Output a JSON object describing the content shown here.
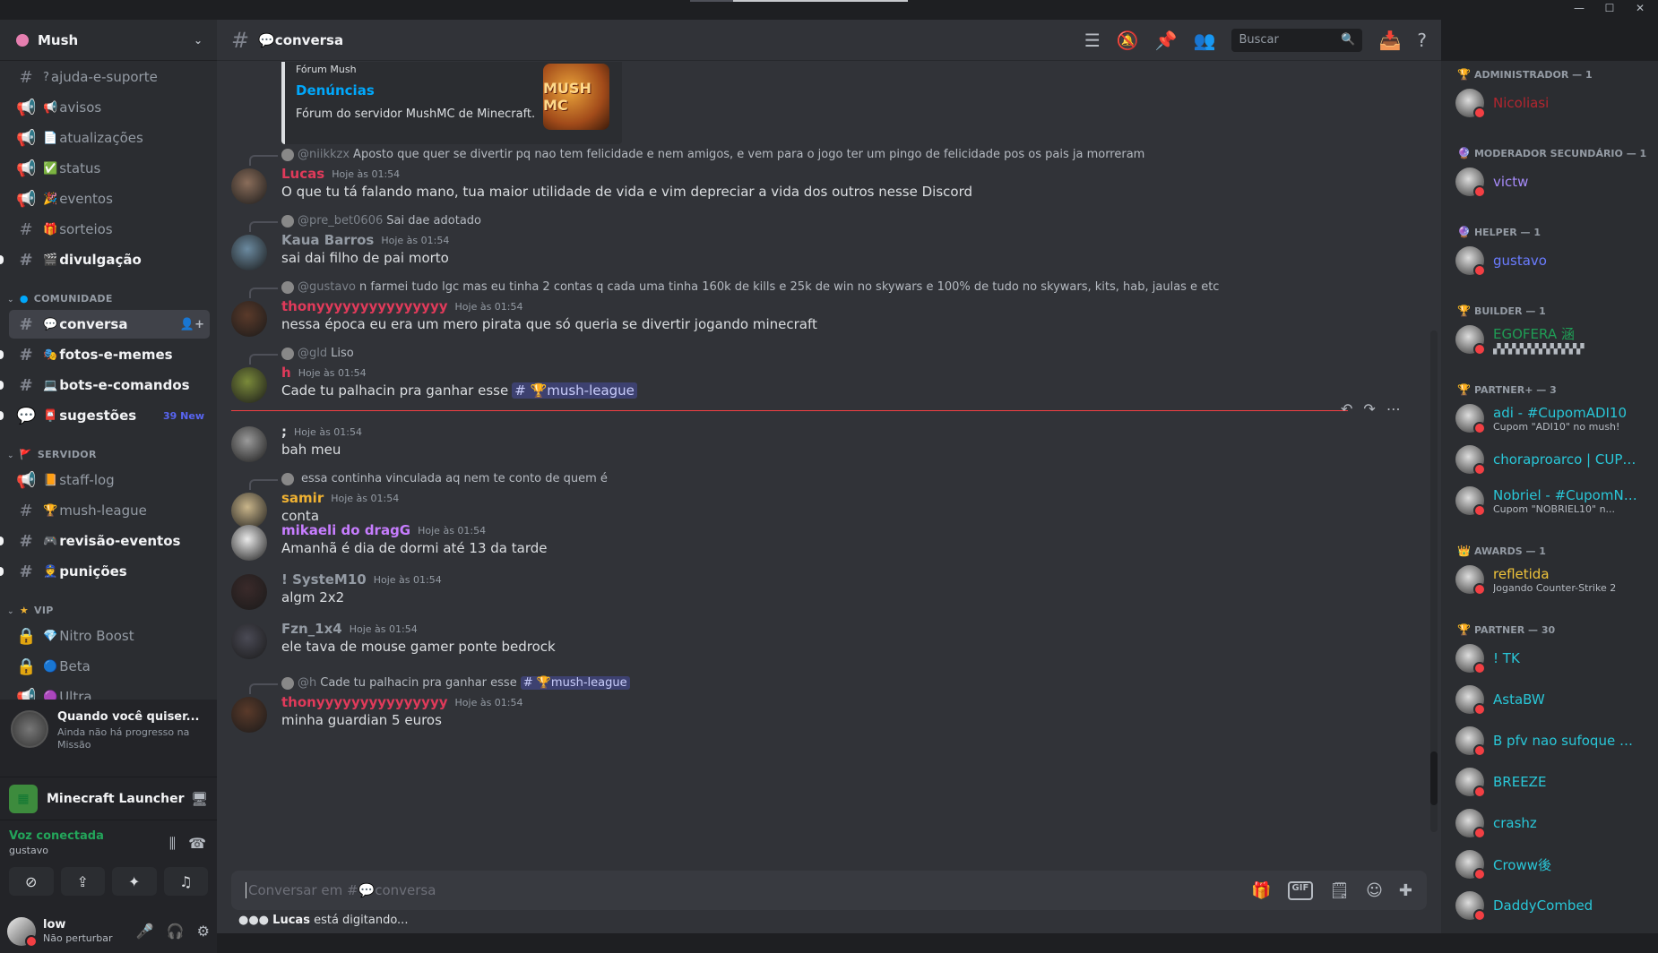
{
  "window": {
    "min": "—",
    "max": "☐",
    "close": "✕"
  },
  "server": {
    "name": "Mush"
  },
  "channels_top": [
    {
      "icon": "#",
      "emoji": "?",
      "label": "ajuda-e-suporte",
      "unread": false
    },
    {
      "icon": "📢",
      "emoji": "📢",
      "label": "avisos",
      "unread": false
    },
    {
      "icon": "📢",
      "emoji": "📄",
      "label": "atualizações",
      "unread": false
    },
    {
      "icon": "📢",
      "emoji": "✅",
      "label": "status",
      "unread": false
    },
    {
      "icon": "📢",
      "emoji": "🎉",
      "label": "eventos",
      "unread": false
    },
    {
      "icon": "#",
      "emoji": "🎁",
      "label": "sorteios",
      "unread": false
    },
    {
      "icon": "#",
      "emoji": "🎬",
      "label": "divulgação",
      "unread": true
    }
  ],
  "categories": {
    "comunidade": "COMUNIDADE",
    "servidor": "SERVIDOR",
    "vip": "VIP"
  },
  "channels_comunidade": [
    {
      "icon": "#",
      "emoji": "💬",
      "label": "conversa",
      "selected": true
    },
    {
      "icon": "#",
      "emoji": "🎭",
      "label": "fotos-e-memes",
      "unread": true
    },
    {
      "icon": "#",
      "emoji": "💻",
      "label": "bots-e-comandos",
      "unread": true
    },
    {
      "icon": "💬",
      "emoji": "📮",
      "label": "sugestões",
      "unread": true,
      "badge": "39 New"
    }
  ],
  "channels_servidor": [
    {
      "icon": "📢",
      "emoji": "📙",
      "label": "staff-log"
    },
    {
      "icon": "#",
      "emoji": "🏆",
      "label": "mush-league"
    },
    {
      "icon": "#",
      "emoji": "🎮",
      "label": "revisão-eventos",
      "unread": true
    },
    {
      "icon": "#",
      "emoji": "👮",
      "label": "punições",
      "unread": true
    }
  ],
  "channels_vip": [
    {
      "icon": "🔒",
      "emoji": "💎",
      "label": "Nitro Boost"
    },
    {
      "icon": "🔒",
      "emoji": "🔵",
      "label": "Beta"
    },
    {
      "icon": "📢",
      "emoji": "🟣",
      "label": "Ultra"
    }
  ],
  "quest": {
    "title": "Quando você quiser...",
    "subtitle": "Ainda não há progresso na Missão"
  },
  "activity": {
    "label": "Minecraft Launcher"
  },
  "voice": {
    "status": "Voz conectada",
    "user": "gustavo"
  },
  "user": {
    "name": "low",
    "status": "Não perturbar"
  },
  "channel": {
    "name": "conversa",
    "emoji": "💬"
  },
  "search": {
    "placeholder": "Buscar"
  },
  "embed": {
    "provider": "Fórum Mush",
    "title": "Denúncias",
    "description": "Fórum do servidor MushMC de Minecraft.",
    "thumb": "MUSH MC"
  },
  "messages": [
    {
      "reply_name": "@niikkzx",
      "reply_text": "Aposto que quer se divertir pq nao tem felicidade e nem amigos, e vem para o jogo ter um pingo de felicidade pos os pais ja morreram",
      "name": "Lucas",
      "name_color": "#e03a5a",
      "time": "Hoje às 01:54",
      "text": "O que tu tá falando mano, tua maior utilidade de vida e vim depreciar a vida dos outros nesse Discord"
    },
    {
      "reply_name": "@pre_bet0606",
      "reply_text": "Sai dae adotado",
      "name": "Kaua Barros",
      "name_color": "#949ba4",
      "time": "Hoje às 01:54",
      "text": "sai dai filho de pai morto"
    },
    {
      "reply_name": "@gustavo",
      "reply_text": "n farmei tudo lgc mas eu tinha 2 contas q cada uma tinha 160k de kills e 25k de win no skywars e 100% de tudo no skywars, kits, hab, jaulas e etc",
      "name": "thonyyyyyyyyyyyyyyy",
      "name_color": "#e03a5a",
      "time": "Hoje às 01:54",
      "text": "nessa época eu era um mero pirata que só queria se divertir jogando minecraft"
    },
    {
      "reply_name": "@gld",
      "reply_text": "Liso",
      "name": "h",
      "name_color": "#e03a5a",
      "time": "Hoje às 01:54",
      "text": "Cade tu palhacin pra ganhar esse",
      "mention": "# 🏆mush-league"
    },
    {
      "name": ";",
      "name_color": "#dbdee1",
      "time": "Hoje às 01:54",
      "text": "bah meu"
    },
    {
      "reply_name": "",
      "reply_text": "essa continha vinculada aq nem te conto de quem é",
      "name": "samir",
      "name_color": "#f0b232",
      "time": "Hoje às 01:54",
      "text": "conta"
    },
    {
      "name": "mikaeli do dragG",
      "name_color": "#c77dff",
      "time": "Hoje às 01:54",
      "text": "Amanhã é dia de dormi até 13 da tarde"
    },
    {
      "name": "!            SysteM10",
      "name_color": "#949ba4",
      "time": "Hoje às 01:54",
      "text": "algm 2x2"
    },
    {
      "name": "Fzn_1x4",
      "name_color": "#949ba4",
      "time": "Hoje às 01:54",
      "text": "ele tava de mouse gamer ponte bedrock"
    },
    {
      "reply_name": "@h",
      "reply_text": "Cade tu palhacin pra ganhar esse",
      "reply_mention": "# 🏆mush-league",
      "name": "thonyyyyyyyyyyyyyyy",
      "name_color": "#e03a5a",
      "time": "Hoje às 01:54",
      "text": "minha guardian 5 euros"
    }
  ],
  "composer": {
    "placeholder": "Conversar em #💬conversa"
  },
  "typing": {
    "user": "Lucas",
    "text": "está digitando..."
  },
  "members": {
    "groups": [
      {
        "label": "ADMINISTRADOR — 1",
        "icon": "🏆",
        "items": [
          {
            "name": "Nicoliasi",
            "color": "#b3262f",
            "status": ""
          }
        ]
      },
      {
        "label": "MODERADOR SECUNDÁRIO — 1",
        "icon": "🔮",
        "items": [
          {
            "name": "victw",
            "color": "#a78bfa",
            "status": ""
          }
        ]
      },
      {
        "label": "HELPER — 1",
        "icon": "🔮",
        "items": [
          {
            "name": "gustavo",
            "color": "#6a7cff",
            "status": ""
          }
        ]
      },
      {
        "label": "BUILDER — 1",
        "icon": "🏆",
        "items": [
          {
            "name": "EGOFERA 涵",
            "color": "#1f9d55",
            "status": "▞▞▞▞▞▞▞▞▞▞▞▞"
          }
        ]
      },
      {
        "label": "PARTNER+ — 3",
        "icon": "🏆",
        "items": [
          {
            "name": "adi - #CupomADI10",
            "color": "#29c7d8",
            "status": "Cupom \"ADI10\" no mush!"
          },
          {
            "name": "choraproarco | CUPO...",
            "color": "#29c7d8",
            "status": ""
          },
          {
            "name": "Nobriel - #CupomNO...",
            "color": "#29c7d8",
            "status": "Cupom \"NOBRIEL10\" n..."
          }
        ]
      },
      {
        "label": "AWARDS — 1",
        "icon": "👑",
        "items": [
          {
            "name": "refletida",
            "color": "#f0c43a",
            "status": "Jogando Counter-Strike 2"
          }
        ]
      },
      {
        "label": "PARTNER — 30",
        "icon": "🏆",
        "items": [
          {
            "name": "! TK",
            "color": "#29c7d8",
            "status": ""
          },
          {
            "name": "AstaBW",
            "color": "#29c7d8",
            "status": ""
          },
          {
            "name": "B pfv nao sufoque o st...",
            "color": "#29c7d8",
            "status": ""
          },
          {
            "name": "BREEZE",
            "color": "#29c7d8",
            "status": ""
          },
          {
            "name": "crashz",
            "color": "#29c7d8",
            "status": ""
          },
          {
            "name": "Croww後",
            "color": "#29c7d8",
            "status": ""
          },
          {
            "name": "DaddyCombed",
            "color": "#29c7d8",
            "status": ""
          }
        ]
      }
    ]
  }
}
